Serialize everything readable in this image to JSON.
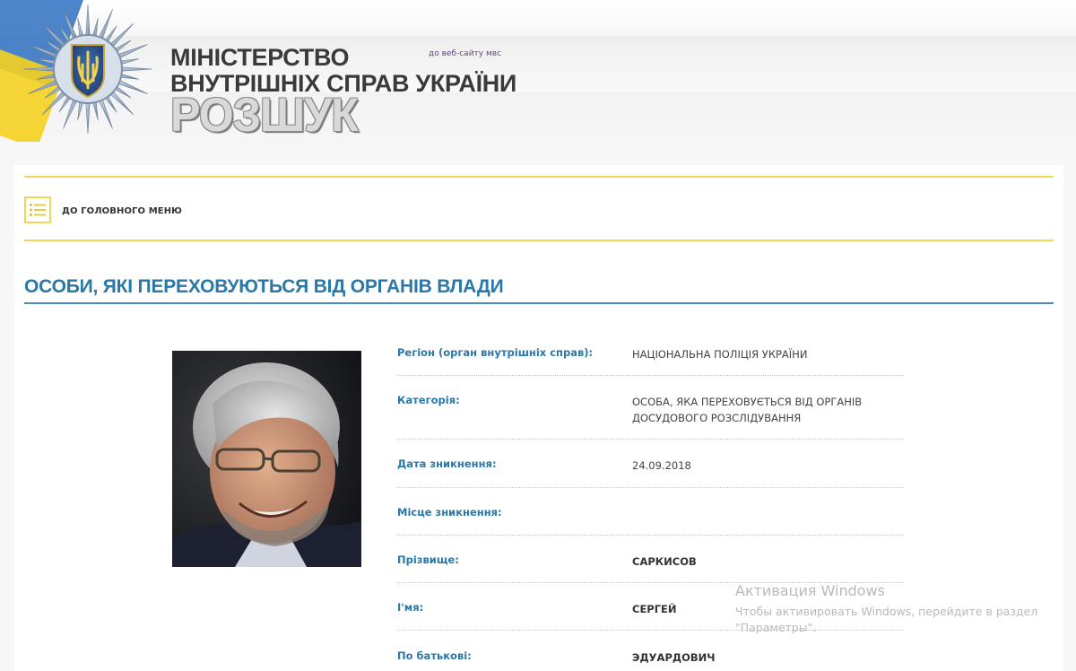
{
  "header": {
    "title_line1": "МІНІСТЕРСТВО",
    "title_line2": "ВНУТРІШНІХ СПРАВ УКРАЇНИ",
    "site_link": "до веб-сайту мвс",
    "subtitle": "РОЗШУК",
    "colors": {
      "flag_blue": "#2f6fc0",
      "flag_yellow": "#f5d21f"
    }
  },
  "nav": {
    "menu_icon": "list-icon",
    "menu_label": "ДО ГОЛОВНОГО МЕНЮ"
  },
  "section": {
    "title": "ОСОБИ, ЯКІ ПЕРЕХОВУЮТЬСЯ ВІД ОРГАНІВ ВЛАДИ",
    "accent_color": "#2a77a9"
  },
  "person": {
    "fields": [
      {
        "label": "Регіон (орган внутрішніх справ):",
        "value": "НАЦІОНАЛЬНА ПОЛІЦІЯ УКРАЇНИ"
      },
      {
        "label": "Категорія:",
        "value": "ОСОБА, ЯКА ПЕРЕХОВУЄТЬСЯ ВІД ОРГАНІВ ДОСУДОВОГО РОЗСЛІДУВАННЯ"
      },
      {
        "label": "Дата зникнення:",
        "value": "24.09.2018"
      },
      {
        "label": "Місце зникнення:",
        "value": ""
      },
      {
        "label": "Прізвище:",
        "value": "САРКИСОВ"
      },
      {
        "label": "І'мя:",
        "value": "СЕРГЕЙ"
      },
      {
        "label": "По батькові:",
        "value": "ЭДУАРДОВИЧ"
      }
    ]
  },
  "watermark": {
    "title": "Активация Windows",
    "text": "Чтобы активировать Windows, перейдите в раздел \"Параметры\"."
  }
}
